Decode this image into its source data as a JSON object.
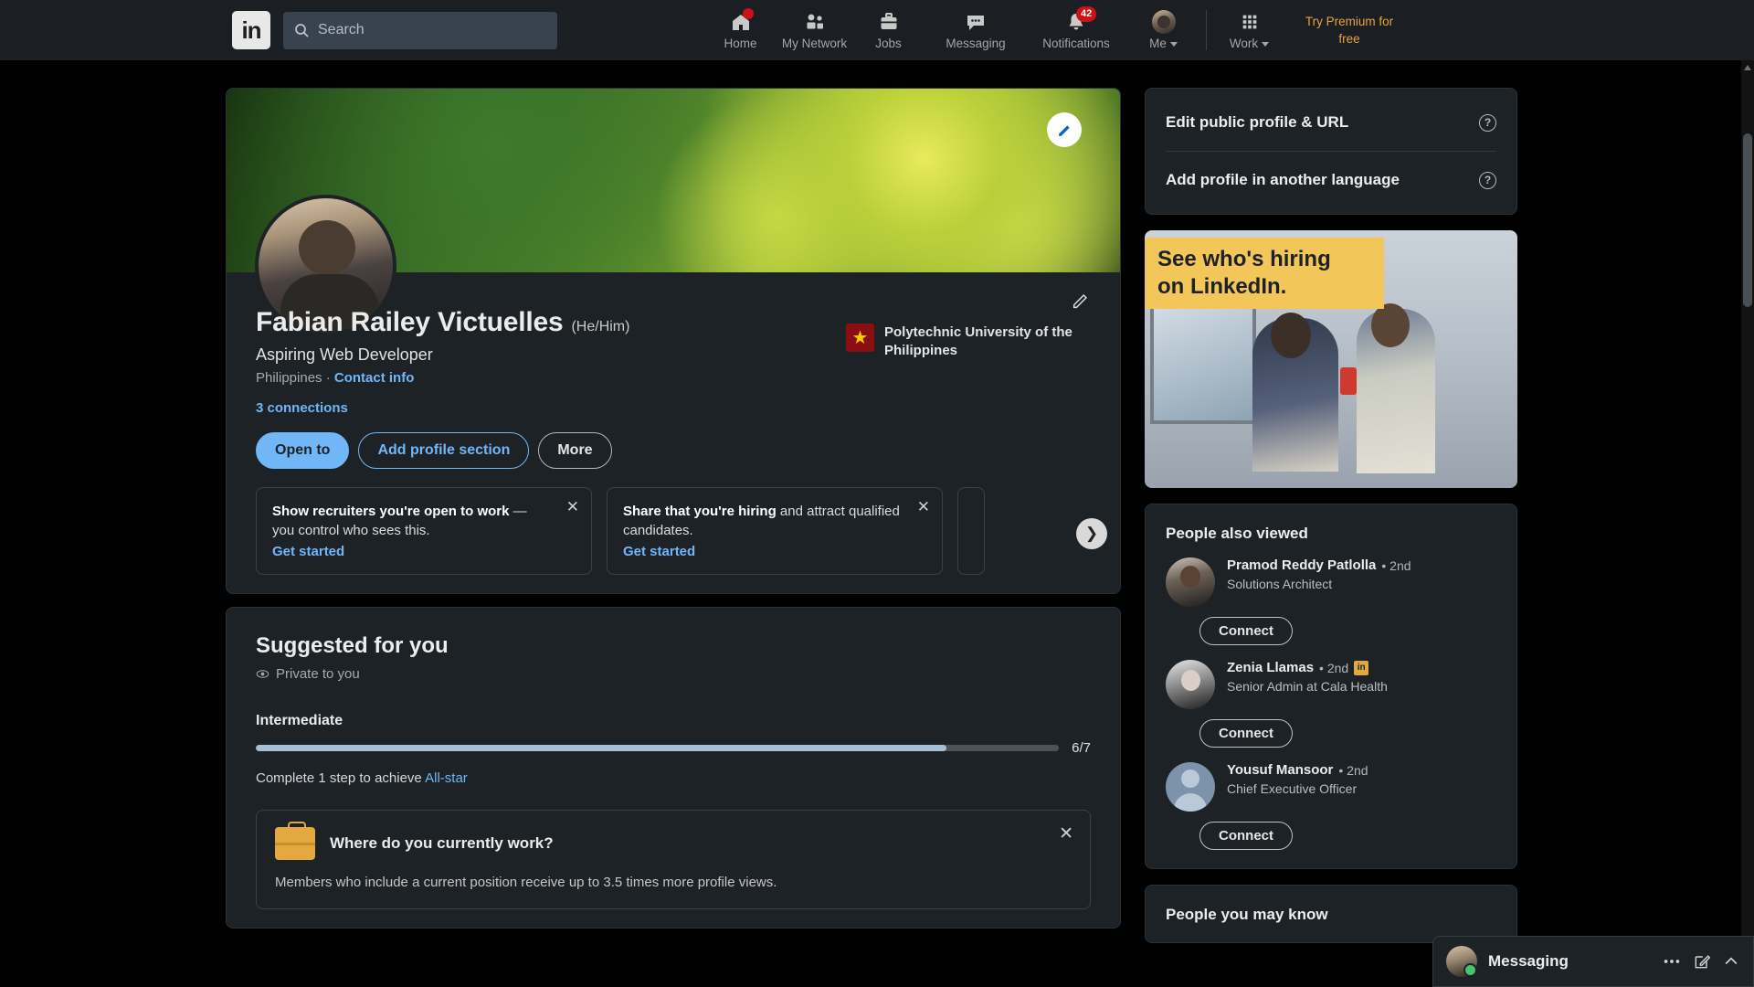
{
  "nav": {
    "logo": "in",
    "search": {
      "placeholder": "Search",
      "value": "",
      "icon": "search-icon"
    },
    "items": [
      {
        "label": "Home",
        "icon": "home-icon",
        "badge": "",
        "badge_dot": true
      },
      {
        "label": "My Network",
        "icon": "people-icon",
        "badge": ""
      },
      {
        "label": "Jobs",
        "icon": "briefcase-icon",
        "badge": ""
      },
      {
        "label": "Messaging",
        "icon": "message-bubble-icon",
        "badge": ""
      },
      {
        "label": "Notifications",
        "icon": "bell-icon",
        "badge": "42"
      },
      {
        "label": "Me",
        "icon": "avatar-icon",
        "badge": "",
        "caret": true
      },
      {
        "label": "Work",
        "icon": "grid-icon",
        "badge": "",
        "caret": true
      }
    ],
    "premium_line1": "Try Premium for",
    "premium_line2": "free",
    "accent_premium": "#e7a33e",
    "accent_badge": "#cc1016"
  },
  "profile": {
    "name": "Fabian Railey Victuelles",
    "pronouns": "(He/Him)",
    "headline": "Aspiring Web Developer",
    "location": "Philippines",
    "location_sep": "·",
    "contact_info": "Contact info",
    "connections": "3 connections",
    "cover_edit_icon": "pencil-icon",
    "edit_icon": "pencil-icon",
    "school": {
      "name": "Polytechnic University of the Philippines",
      "logo_icon": "star-logo-icon"
    },
    "buttons": [
      {
        "label": "Open to",
        "style": "primary"
      },
      {
        "label": "Add profile section",
        "style": "outline-blue"
      },
      {
        "label": "More",
        "style": "outline-white"
      }
    ],
    "promos": [
      {
        "bold": "Show recruiters you're open to work",
        "rest": " — you control who sees this.",
        "link": "Get started",
        "close_icon": "close-icon"
      },
      {
        "bold": "Share that you're hiring",
        "rest": " and attract qualified candidates.",
        "link": "Get started",
        "close_icon": "close-icon"
      }
    ],
    "promo_next_icon": "chevron-right-icon"
  },
  "suggested": {
    "title": "Suggested for you",
    "privacy": "Private to you",
    "privacy_icon": "eye-icon",
    "level": "Intermediate",
    "progress_label": "6/7",
    "progress_percent": 86,
    "next_step_prefix": "Complete 1 step to achieve ",
    "next_step_link": "All-star",
    "task": {
      "icon": "briefcase-icon",
      "question": "Where do you currently work?",
      "body": "Members who include a current position receive up to 3.5 times more profile views.",
      "close_icon": "close-icon"
    }
  },
  "sidebar": {
    "links": [
      {
        "label": "Edit public profile & URL",
        "help_icon": "question-icon"
      },
      {
        "label": "Add profile in another language",
        "help_icon": "question-icon"
      }
    ],
    "ad": {
      "line1": "See who's hiring",
      "line2": "on LinkedIn.",
      "band_color": "#f3c65a"
    },
    "people_also_viewed": {
      "title": "People also viewed",
      "people": [
        {
          "name": "Pramod Reddy Patlolla",
          "degree": "• 2nd",
          "role": "Solutions Architect",
          "action": "Connect",
          "avatar": "avatar-pramod",
          "premium_badge": false
        },
        {
          "name": "Zenia Llamas",
          "degree": "• 2nd",
          "role": "Senior Admin at Cala Health",
          "action": "Connect",
          "avatar": "avatar-zenia",
          "premium_badge": true
        },
        {
          "name": "Yousuf Mansoor",
          "degree": "• 2nd",
          "role": "Chief Executive Officer",
          "action": "Connect",
          "avatar": "avatar-yousuf",
          "premium_badge": false
        }
      ]
    },
    "people_you_may_know": {
      "title": "People you may know"
    }
  },
  "dock": {
    "title": "Messaging",
    "more_icon": "ellipsis-icon",
    "compose_icon": "compose-pencil-icon",
    "expand_icon": "chevron-up-icon",
    "status": "online"
  }
}
